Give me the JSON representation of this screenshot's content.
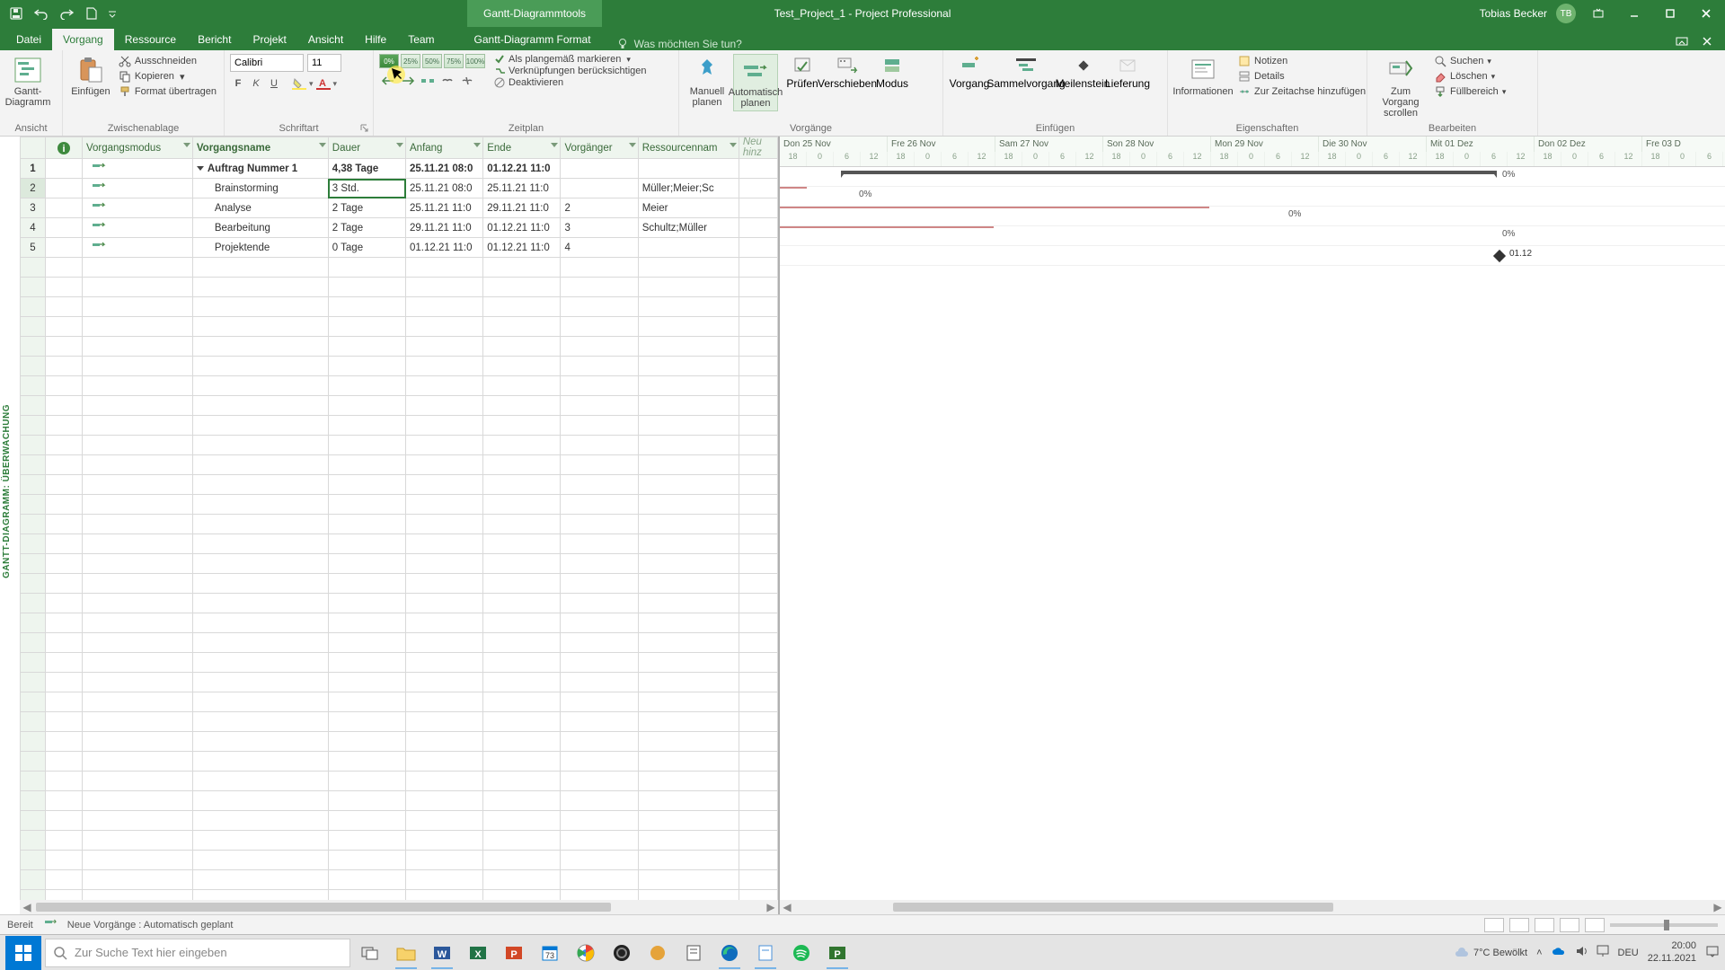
{
  "title": {
    "context_tool": "Gantt-Diagrammtools",
    "doc": "Test_Project_1  -  Project Professional",
    "user_name": "Tobias Becker",
    "user_initials": "TB"
  },
  "tabs": {
    "datei": "Datei",
    "vorgang": "Vorgang",
    "ressource": "Ressource",
    "bericht": "Bericht",
    "projekt": "Projekt",
    "ansicht": "Ansicht",
    "hilfe": "Hilfe",
    "team": "Team",
    "format": "Gantt-Diagramm Format",
    "tell_me": "Was möchten Sie tun?"
  },
  "ribbon": {
    "ansicht_group": "Ansicht",
    "gantt_btn": "Gantt-\nDiagramm",
    "zwischenablage_group": "Zwischenablage",
    "einfuegen_btn": "Einfügen",
    "ausschneiden": "Ausschneiden",
    "kopieren": "Kopieren",
    "format_uebertragen": "Format übertragen",
    "schriftart_group": "Schriftart",
    "font_name": "Calibri",
    "font_size": "11",
    "zeitplan_group": "Zeitplan",
    "als_plan": "Als plangemäß markieren",
    "verkn": "Verknüpfungen berücksichtigen",
    "deakt": "Deaktivieren",
    "vorgaenge_group": "Vorgänge",
    "manuell": "Manuell\nplanen",
    "auto": "Automatisch\nplanen",
    "pruefen": "Prüfen",
    "verschieben": "Verschieben",
    "modus": "Modus",
    "einfuegen_group": "Einfügen",
    "vorgang_btn": "Vorgang",
    "sammel": "Sammelvorgang",
    "meilenstein": "Meilenstein",
    "lieferung": "Lieferung",
    "eigenschaften_group": "Eigenschaften",
    "informationen": "Informationen",
    "notizen": "Notizen",
    "details": "Details",
    "zeitachse": "Zur Zeitachse hinzufügen",
    "bearbeiten_group": "Bearbeiten",
    "zum_vorgang": "Zum Vorgang\nscrollen",
    "suchen": "Suchen",
    "loeschen": "Löschen",
    "fuell": "Füllbereich"
  },
  "side_label": "GANTT-DIAGRAMM: ÜBERWACHUNG",
  "columns": {
    "info": "",
    "modus": "Vorgangsmodus",
    "name": "Vorgangsname",
    "dauer": "Dauer",
    "anfang": "Anfang",
    "ende": "Ende",
    "vorgaenger": "Vorgänger",
    "ressourcen": "Ressourcennam",
    "neu": "Neu\nhinz"
  },
  "rows": [
    {
      "n": 1,
      "name": "Auftrag Nummer 1",
      "dauer": "4,38 Tage",
      "anfang": "25.11.21 08:0",
      "ende": "01.12.21 11:0",
      "vorg": "",
      "res": "",
      "summary": true
    },
    {
      "n": 2,
      "name": "Brainstorming",
      "dauer": "3 Std.",
      "anfang": "25.11.21 08:0",
      "ende": "25.11.21 11:0",
      "vorg": "",
      "res": "Müller;Meier;Sc"
    },
    {
      "n": 3,
      "name": "Analyse",
      "dauer": "2 Tage",
      "anfang": "25.11.21 11:0",
      "ende": "29.11.21 11:0",
      "vorg": "2",
      "res": "Meier"
    },
    {
      "n": 4,
      "name": "Bearbeitung",
      "dauer": "2 Tage",
      "anfang": "29.11.21 11:0",
      "ende": "01.12.21 11:0",
      "vorg": "3",
      "res": "Schultz;Müller"
    },
    {
      "n": 5,
      "name": "Projektende",
      "dauer": "0 Tage",
      "anfang": "01.12.21 11:0",
      "ende": "01.12.21 11:0",
      "vorg": "4",
      "res": ""
    }
  ],
  "timeline": {
    "days": [
      "Don 25 Nov",
      "Fre 26 Nov",
      "Sam 27 Nov",
      "Son 28 Nov",
      "Mon 29 Nov",
      "Die 30 Nov",
      "Mit 01 Dez",
      "Don 02 Dez",
      "Fre 03 D"
    ],
    "hours": [
      "18",
      "0",
      "6",
      "12"
    ]
  },
  "gantt_labels": {
    "pct0": "0%",
    "mile": "01.12"
  },
  "status": {
    "ready": "Bereit",
    "auto": "Neue Vorgänge : Automatisch geplant"
  },
  "taskbar": {
    "search_placeholder": "Zur Suche Text hier eingeben",
    "weather": "7°C  Bewölkt",
    "lang": "DEU",
    "time": "20:00",
    "date": "22.11.2021"
  }
}
